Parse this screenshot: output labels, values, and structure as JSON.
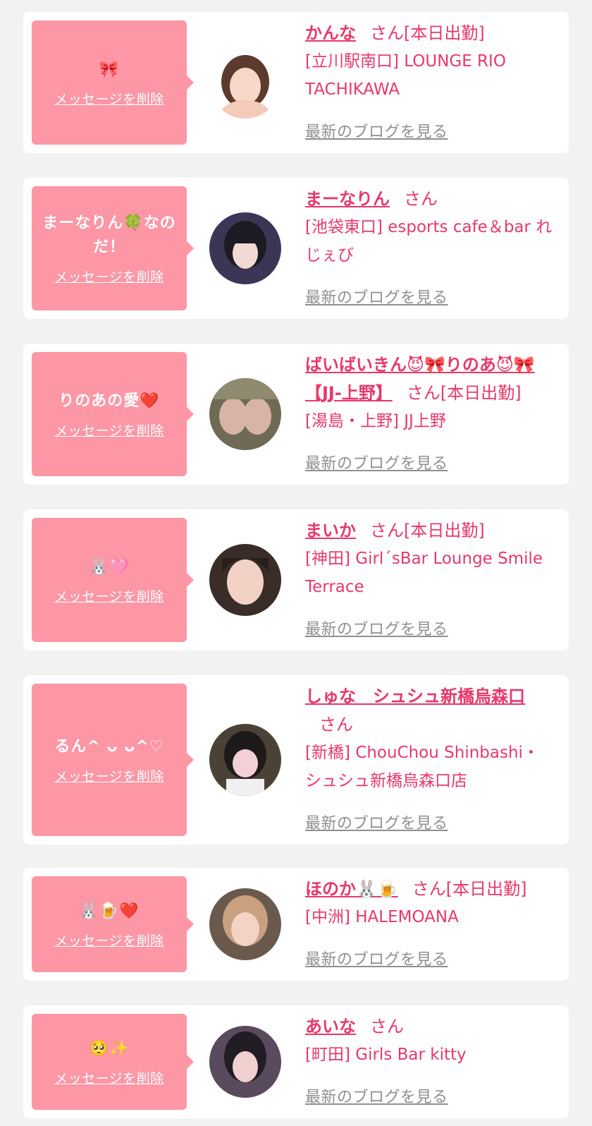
{
  "delete_label": "メッセージを削除",
  "blog_label": "最新のブログを見る",
  "entries": [
    {
      "message": "🎀",
      "name": "かんな",
      "san_status": "さん[本日出勤]",
      "shop": "[立川駅南口] LOUNGE RIO TACHIKAWA"
    },
    {
      "message": "まーなりん🍀なのだ！",
      "name": "まーなりん",
      "san_status": "さん",
      "shop": "[池袋東口] esports cafe＆bar れじぇび"
    },
    {
      "message": "りのあの愛❤️",
      "name": "ばいばいきん😈🎀りのあ😈🎀【JJ-上野】",
      "san_status": "さん[本日出勤]",
      "shop": "[湯島・上野] JJ上野"
    },
    {
      "message": "🐰🩷",
      "name": "まいか",
      "san_status": "さん[本日出勤]",
      "shop": "[神田] Girl´sBar Lounge Smile Terrace"
    },
    {
      "message": "るん^ ᴗ ᴗ^♡",
      "name": "しゅな　シュシュ新橋烏森口",
      "san_status": "さん",
      "shop": "[新橋] ChouChou Shinbashi・シュシュ新橋烏森口店"
    },
    {
      "message": "🐰🍺❤️",
      "name": "ほのか🐰🍺",
      "san_status": "さん[本日出勤]",
      "shop": "[中洲] HALEMOANA"
    },
    {
      "message": "🥺✨",
      "name": "あいな",
      "san_status": "さん",
      "shop": "[町田] Girls Bar kitty"
    }
  ],
  "colors": {
    "page_bg": "#f2f2f2",
    "bubble": "#fd96a5",
    "accent": "#e8386b",
    "muted": "#8f8f8f"
  }
}
